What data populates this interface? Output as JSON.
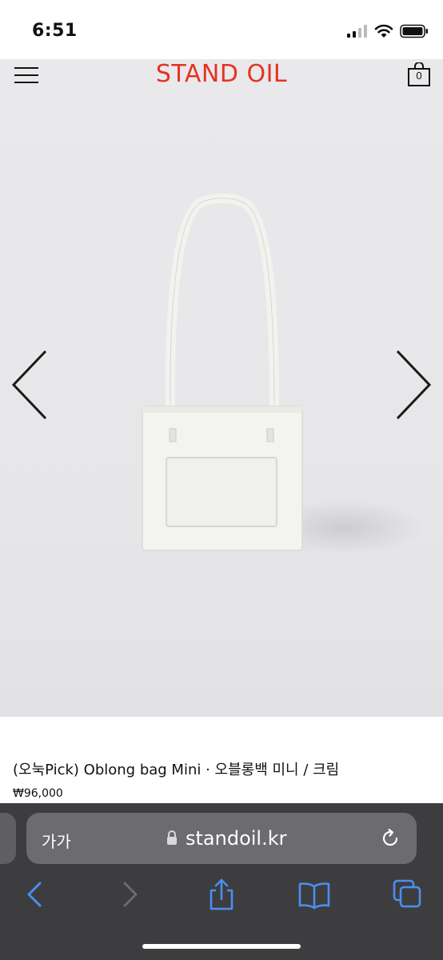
{
  "status_bar": {
    "time": "6:51"
  },
  "header": {
    "logo": "STAND OIL",
    "cart_count": "0"
  },
  "product": {
    "title": "(오눅Pick) Oblong bag Mini · 오블롱백 미니 / 크림",
    "price": "₩96,000"
  },
  "browser": {
    "aa_label": "가가",
    "url": "standoil.kr"
  },
  "colors": {
    "brand": "#e53322",
    "browser_bar": "#3d3d40",
    "toolbar_icon": "#4a8ff0"
  }
}
